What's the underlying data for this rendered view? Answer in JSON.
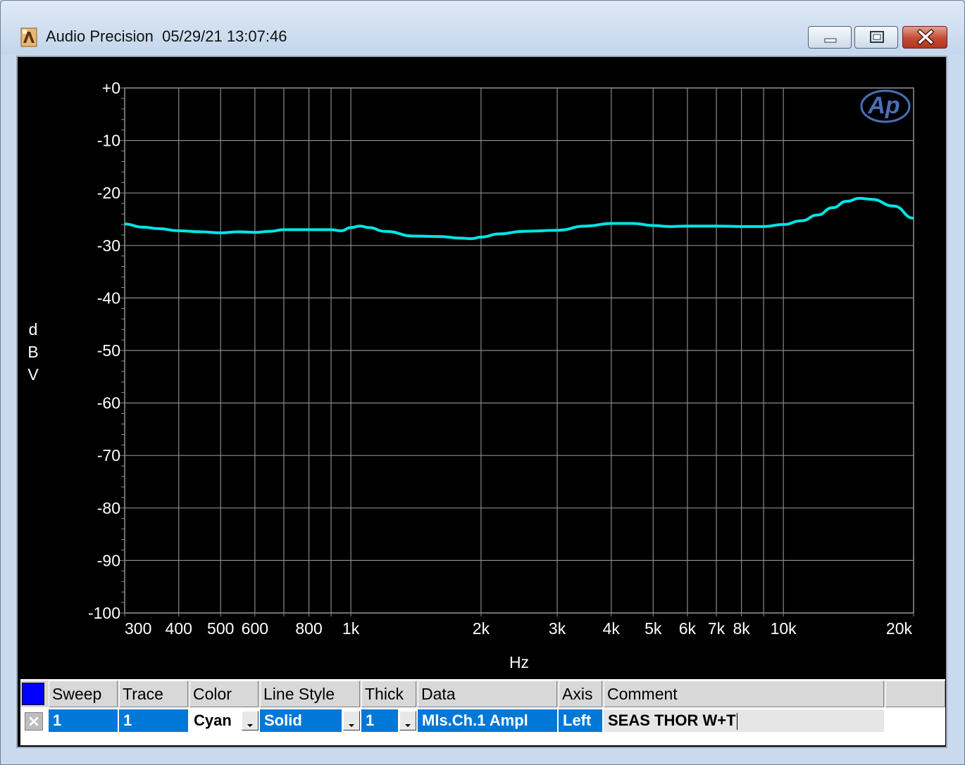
{
  "window": {
    "title": "Audio Precision  05/29/21 13:07:46",
    "icon": "audio-precision-app-icon",
    "controls": [
      "minimize-icon",
      "maximize-icon",
      "close-icon"
    ]
  },
  "colors": {
    "trace": "#00e5e5",
    "grid": "#8a8a8a",
    "background": "#000000",
    "text": "#ffffff",
    "logo": "#4a6fb5"
  },
  "chart_data": {
    "type": "line",
    "title": "",
    "xlabel": "Hz",
    "ylabel": "dBV",
    "xscale": "log",
    "xlim": [
      300,
      20000
    ],
    "ylim": [
      -100,
      0
    ],
    "grid": true,
    "logo": "Ap",
    "x_tick_labels": [
      {
        "value": 300,
        "label": "300"
      },
      {
        "value": 400,
        "label": "400"
      },
      {
        "value": 500,
        "label": "500"
      },
      {
        "value": 600,
        "label": "600"
      },
      {
        "value": 800,
        "label": "800"
      },
      {
        "value": 1000,
        "label": "1k"
      },
      {
        "value": 2000,
        "label": "2k"
      },
      {
        "value": 3000,
        "label": "3k"
      },
      {
        "value": 4000,
        "label": "4k"
      },
      {
        "value": 5000,
        "label": "5k"
      },
      {
        "value": 6000,
        "label": "6k"
      },
      {
        "value": 7000,
        "label": "7k"
      },
      {
        "value": 8000,
        "label": "8k"
      },
      {
        "value": 10000,
        "label": "10k"
      },
      {
        "value": 20000,
        "label": "20k"
      }
    ],
    "x_grid": [
      300,
      400,
      500,
      600,
      700,
      800,
      900,
      1000,
      2000,
      3000,
      4000,
      5000,
      6000,
      7000,
      8000,
      9000,
      10000,
      20000
    ],
    "y_tick_labels": [
      {
        "value": 0,
        "label": "+0"
      },
      {
        "value": -10,
        "label": "-10"
      },
      {
        "value": -20,
        "label": "-20"
      },
      {
        "value": -30,
        "label": "-30"
      },
      {
        "value": -40,
        "label": "-40"
      },
      {
        "value": -50,
        "label": "-50"
      },
      {
        "value": -60,
        "label": "-60"
      },
      {
        "value": -70,
        "label": "-70"
      },
      {
        "value": -80,
        "label": "-80"
      },
      {
        "value": -90,
        "label": "-90"
      },
      {
        "value": -100,
        "label": "-100"
      }
    ],
    "series": [
      {
        "name": "1",
        "x": [
          300,
          330,
          360,
          400,
          450,
          500,
          550,
          600,
          650,
          700,
          800,
          900,
          950,
          1000,
          1050,
          1100,
          1200,
          1400,
          1600,
          1800,
          1900,
          2000,
          2200,
          2500,
          3000,
          3500,
          4000,
          4500,
          5000,
          5500,
          6000,
          7000,
          8000,
          9000,
          10000,
          11000,
          12000,
          13000,
          14000,
          15000,
          16000,
          18000,
          20000
        ],
        "y": [
          -25.9,
          -26.5,
          -26.8,
          -27.2,
          -27.4,
          -27.6,
          -27.4,
          -27.5,
          -27.3,
          -27.0,
          -27.0,
          -27.0,
          -27.2,
          -26.6,
          -26.3,
          -26.6,
          -27.3,
          -28.2,
          -28.3,
          -28.6,
          -28.7,
          -28.4,
          -27.8,
          -27.3,
          -27.1,
          -26.3,
          -25.8,
          -25.8,
          -26.2,
          -26.4,
          -26.3,
          -26.3,
          -26.4,
          -26.4,
          -26.0,
          -25.3,
          -24.2,
          -22.8,
          -21.6,
          -21.0,
          -21.2,
          -22.5,
          -24.8
        ]
      }
    ]
  },
  "legend": {
    "selected_color": "#0000ff",
    "headers": [
      "Sweep",
      "Trace",
      "Color",
      "Line Style",
      "Thick",
      "Data",
      "Axis",
      "Comment"
    ],
    "row": {
      "enabled_icon": "checkbox-x-icon",
      "sweep": "1",
      "trace": "1",
      "color": "Cyan",
      "line_style": "Solid",
      "thick": "1",
      "data": "Mls.Ch.1 Ampl",
      "axis": "Left",
      "comment": "SEAS THOR W+T"
    }
  }
}
